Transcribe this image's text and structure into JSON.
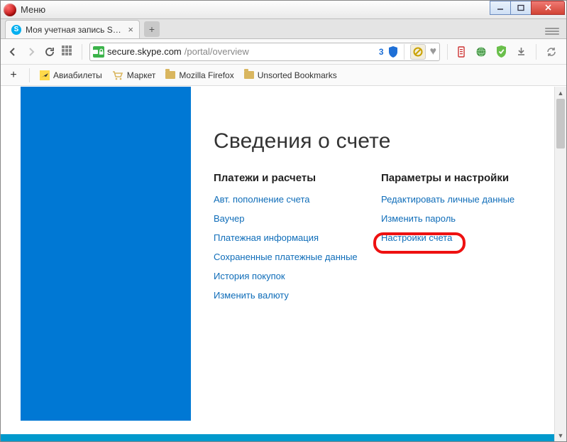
{
  "window": {
    "menu": "Меню"
  },
  "tab": {
    "title": "Моя учетная запись Skyp"
  },
  "address": {
    "host": "secure.skype.com",
    "path": "/portal/overview",
    "badge_count": "3"
  },
  "bookmarks": {
    "avia": "Авиабилеты",
    "market": "Маркет",
    "mozilla": "Mozilla Firefox",
    "unsorted": "Unsorted Bookmarks"
  },
  "page": {
    "heading": "Сведения о счете",
    "col1": {
      "title": "Платежи и расчеты",
      "links": [
        "Авт. пополнение счета",
        "Ваучер",
        "Платежная информация",
        "Сохраненные платежные данные",
        "История покупок",
        "Изменить валюту"
      ]
    },
    "col2": {
      "title": "Параметры и настройки",
      "links": [
        "Редактировать личные данные",
        "Изменить пароль",
        "Настройки счета"
      ]
    }
  }
}
